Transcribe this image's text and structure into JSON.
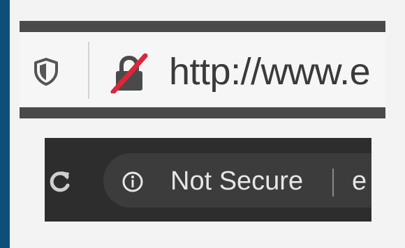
{
  "colors": {
    "outer_background": "#0e4f7a",
    "panel_background": "#f3f3f3",
    "toolbar_dark": "#2d2d2d",
    "pill_background": "#3c3c3c",
    "insecure_slash": "#e0243a"
  },
  "light_toolbar": {
    "tracking_icon": "shield-icon",
    "lock_icon": "lock-insecure-icon",
    "url_text": "http://www.e"
  },
  "dark_toolbar": {
    "reload_icon": "reload-icon",
    "info_icon": "info-icon",
    "security_label": "Not Secure",
    "url_fragment": "e"
  }
}
